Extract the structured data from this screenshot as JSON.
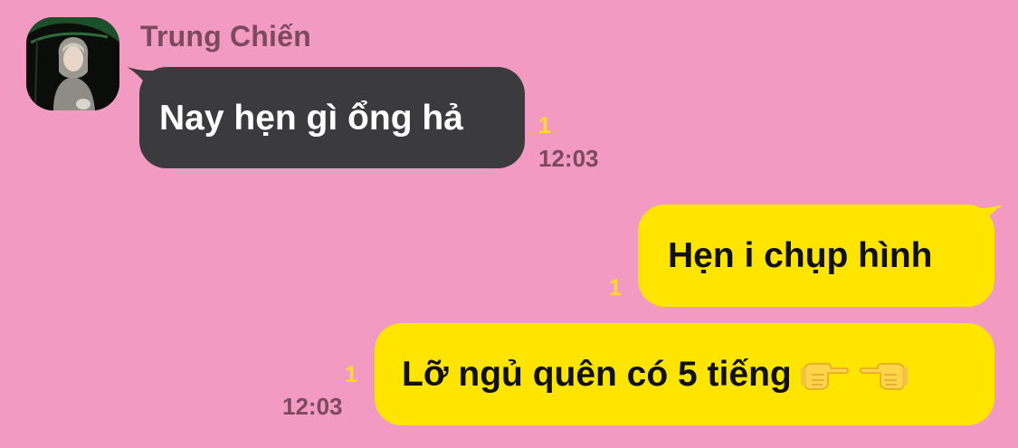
{
  "messages": [
    {
      "sender": "Trung Chiến",
      "text": "Nay hẹn gì ổng hả",
      "unread": "1",
      "time": "12:03",
      "direction": "incoming"
    },
    {
      "text": "Hẹn i chụp hình",
      "unread": "1",
      "direction": "outgoing"
    },
    {
      "text": "Lỡ ngủ quên có 5 tiếng",
      "emoji": [
        "pointing-right-hand-icon",
        "pointing-left-hand-icon"
      ],
      "unread": "1",
      "time": "12:03",
      "direction": "outgoing"
    }
  ],
  "colors": {
    "background": "#f29ac2",
    "incoming_bubble": "#3b3b3d",
    "outgoing_bubble": "#fee500",
    "unread_count": "#ffde1a",
    "meta_text": "#7b4a5f"
  }
}
